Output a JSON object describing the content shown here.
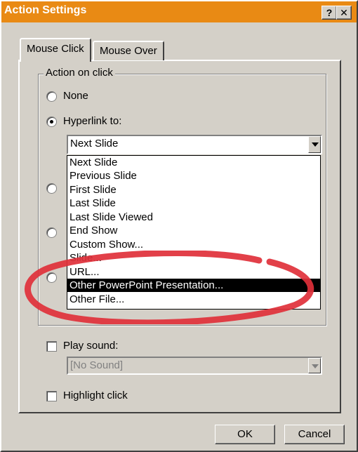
{
  "window": {
    "title": "Action Settings",
    "help_label": "?",
    "close_label": "✕"
  },
  "tabs": [
    {
      "label": "Mouse Click",
      "active": true
    },
    {
      "label": "Mouse Over",
      "active": false
    }
  ],
  "group": {
    "label": "Action on click"
  },
  "options": {
    "none": {
      "label": "None",
      "checked": false
    },
    "hyperlink": {
      "label": "Hyperlink to:",
      "checked": true
    }
  },
  "hyperlink_combo": {
    "value": "Next Slide"
  },
  "dropdown_items": [
    "Next Slide",
    "Previous Slide",
    "First Slide",
    "Last Slide",
    "Last Slide Viewed",
    "End Show",
    "Custom Show...",
    "Slide...",
    "URL...",
    "Other PowerPoint Presentation...",
    "Other File..."
  ],
  "dropdown_selected_index": 9,
  "sound": {
    "label": "Play sound:",
    "value": "[No Sound]",
    "checked": false
  },
  "highlight": {
    "label": "Highlight click",
    "checked": false
  },
  "buttons": {
    "ok": "OK",
    "cancel": "Cancel"
  },
  "colors": {
    "titlebar": "#e98a14",
    "annotation": "#e0303a",
    "selection": "#000000"
  }
}
